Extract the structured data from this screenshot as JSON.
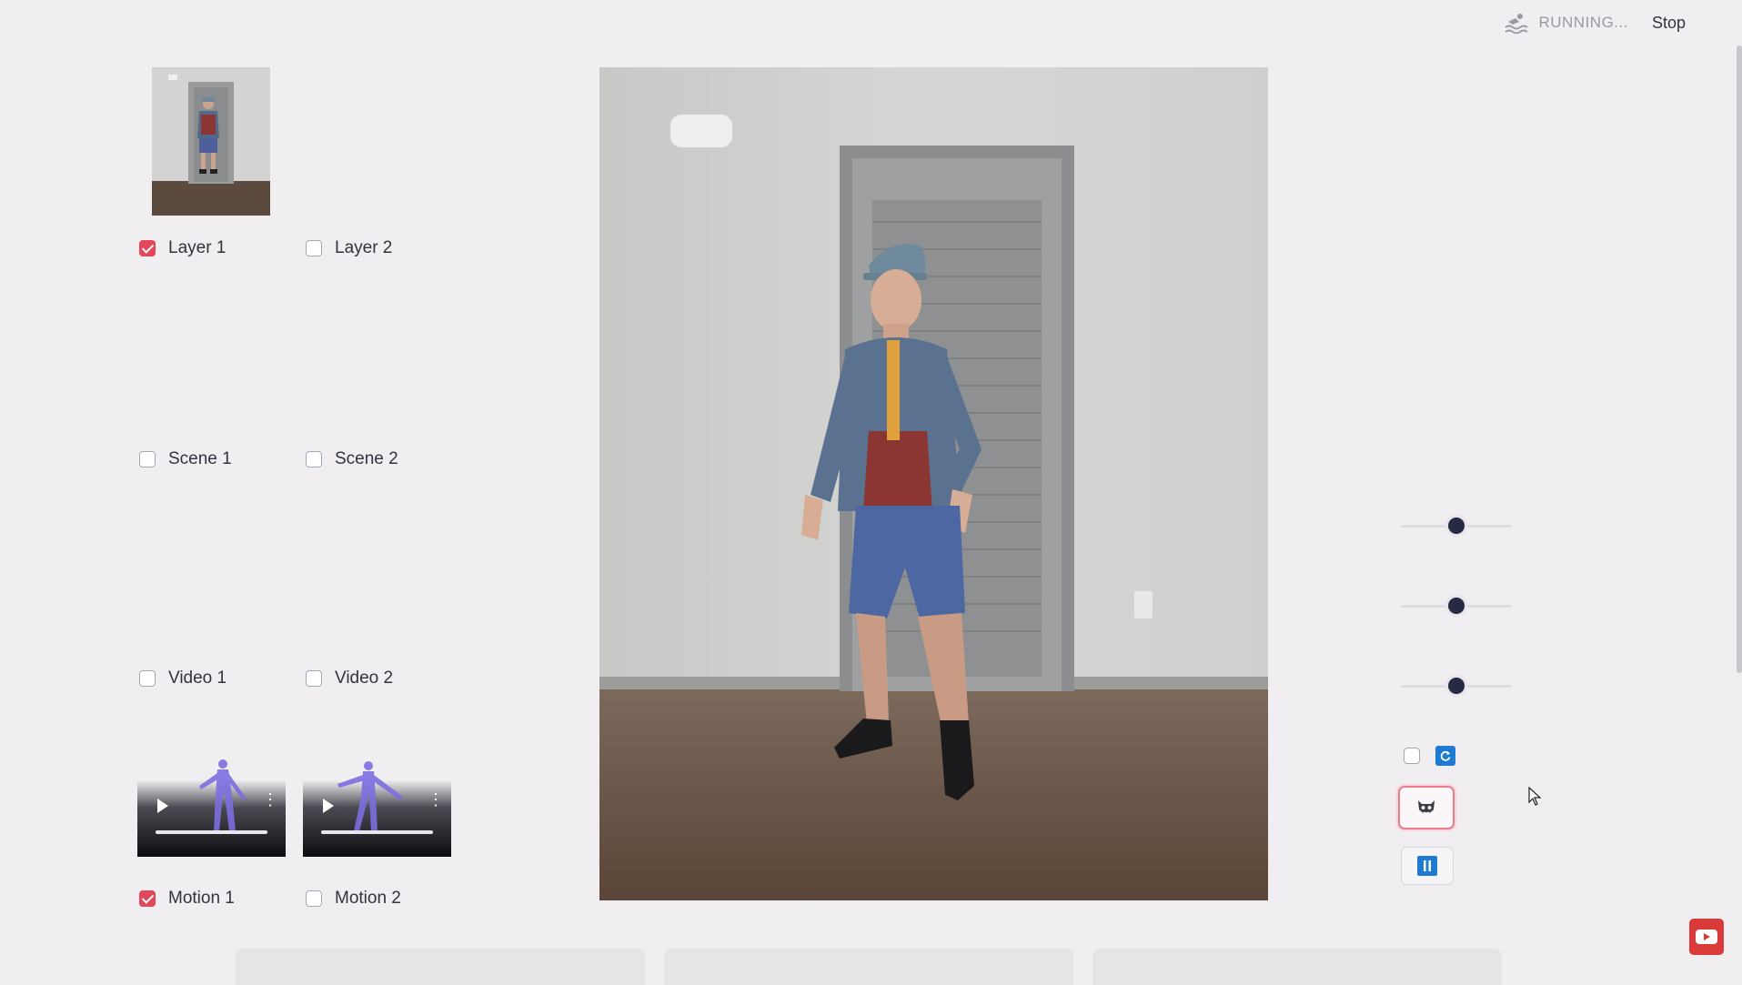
{
  "header": {
    "status_text": "RUNNING...",
    "stop_label": "Stop"
  },
  "layers": [
    {
      "label": "Layer 1",
      "checked": true
    },
    {
      "label": "Layer 2",
      "checked": false
    }
  ],
  "scenes": [
    {
      "label": "Scene 1",
      "checked": false
    },
    {
      "label": "Scene 2",
      "checked": false
    }
  ],
  "videos": [
    {
      "label": "Video 1",
      "checked": false
    },
    {
      "label": "Video 2",
      "checked": false
    }
  ],
  "motions": [
    {
      "label": "Motion 1",
      "checked": true
    },
    {
      "label": "Motion 2",
      "checked": false
    }
  ],
  "sliders": [
    {
      "value": 0.5
    },
    {
      "value": 0.5
    },
    {
      "value": 0.5
    }
  ],
  "icons": {
    "status": "swimmer-icon",
    "refresh": "refresh-icon",
    "mask": "mask-face-icon",
    "pause": "pause-icon",
    "youtube": "youtube-subscribe-icon"
  },
  "colors": {
    "accent": "#e2475b",
    "slider_knob": "#262a42",
    "refresh_blue": "#1f7bd1"
  }
}
